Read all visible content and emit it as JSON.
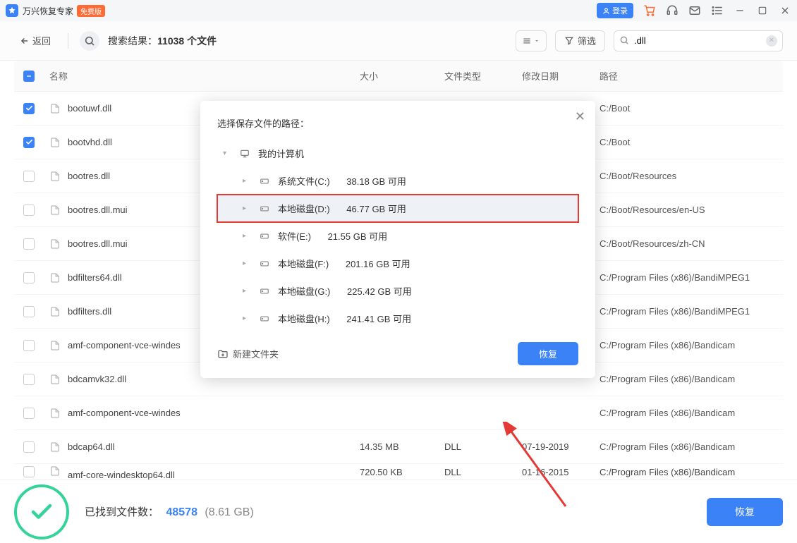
{
  "titlebar": {
    "app_name": "万兴恢复专家",
    "badge": "免费版",
    "login": "登录"
  },
  "toolbar": {
    "back": "返回",
    "search_label_prefix": "搜索结果：",
    "search_count": "11038 个文件",
    "filter": "筛选",
    "search_value": ".dll"
  },
  "columns": {
    "name": "名称",
    "size": "大小",
    "type": "文件类型",
    "date": "修改日期",
    "path": "路径"
  },
  "files": [
    {
      "checked": true,
      "name": "bootuwf.dll",
      "size": "",
      "type": "",
      "date": "",
      "path": "C:/Boot"
    },
    {
      "checked": true,
      "name": "bootvhd.dll",
      "size": "",
      "type": "",
      "date": "",
      "path": "C:/Boot"
    },
    {
      "checked": false,
      "name": "bootres.dll",
      "size": "",
      "type": "",
      "date": "",
      "path": "C:/Boot/Resources"
    },
    {
      "checked": false,
      "name": "bootres.dll.mui",
      "size": "",
      "type": "",
      "date": "",
      "path": "C:/Boot/Resources/en-US"
    },
    {
      "checked": false,
      "name": "bootres.dll.mui",
      "size": "",
      "type": "",
      "date": "",
      "path": "C:/Boot/Resources/zh-CN"
    },
    {
      "checked": false,
      "name": "bdfilters64.dll",
      "size": "",
      "type": "",
      "date": "",
      "path": "C:/Program Files (x86)/BandiMPEG1"
    },
    {
      "checked": false,
      "name": "bdfilters.dll",
      "size": "",
      "type": "",
      "date": "",
      "path": "C:/Program Files (x86)/BandiMPEG1"
    },
    {
      "checked": false,
      "name": "amf-component-vce-windes",
      "size": "",
      "type": "",
      "date": "",
      "path": "C:/Program Files (x86)/Bandicam"
    },
    {
      "checked": false,
      "name": "bdcamvk32.dll",
      "size": "",
      "type": "",
      "date": "",
      "path": "C:/Program Files (x86)/Bandicam"
    },
    {
      "checked": false,
      "name": "amf-component-vce-windes",
      "size": "",
      "type": "",
      "date": "",
      "path": "C:/Program Files (x86)/Bandicam"
    },
    {
      "checked": false,
      "name": "bdcap64.dll",
      "size": "14.35 MB",
      "type": "DLL",
      "date": "07-19-2019",
      "path": "C:/Program Files (x86)/Bandicam"
    },
    {
      "checked": false,
      "name": "amf-core-windesktop64.dll",
      "size": "720.50 KB",
      "type": "DLL",
      "date": "01-16-2015",
      "path": "C:/Program Files (x86)/Bandicam"
    }
  ],
  "footer": {
    "label": "已找到文件数：",
    "count": "48578",
    "size": "(8.61 GB)",
    "recover": "恢复"
  },
  "modal": {
    "title": "选择保存文件的路径：",
    "root": "我的计算机",
    "drives": [
      {
        "label": "系统文件(C:)",
        "free": "38.18 GB 可用",
        "highlight": false
      },
      {
        "label": "本地磁盘(D:)",
        "free": "46.77 GB 可用",
        "highlight": true
      },
      {
        "label": "软件(E:)",
        "free": "21.55 GB 可用",
        "highlight": false
      },
      {
        "label": "本地磁盘(F:)",
        "free": "201.16 GB 可用",
        "highlight": false
      },
      {
        "label": "本地磁盘(G:)",
        "free": "225.42 GB 可用",
        "highlight": false
      },
      {
        "label": "本地磁盘(H:)",
        "free": "241.41 GB 可用",
        "highlight": false
      }
    ],
    "new_folder": "新建文件夹",
    "recover": "恢复"
  }
}
